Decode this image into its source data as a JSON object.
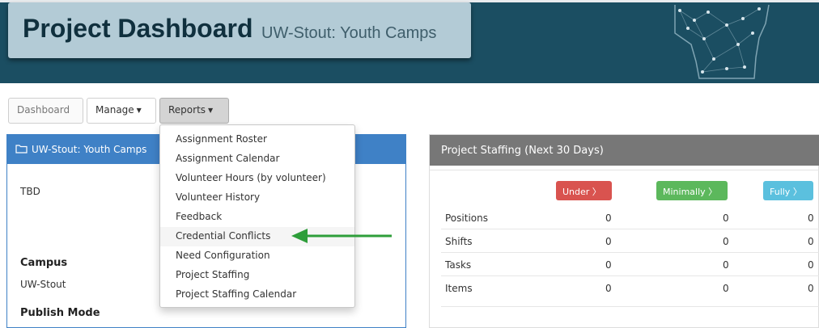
{
  "header": {
    "title": "Project Dashboard",
    "subtitle": "UW-Stout: Youth Camps",
    "logo_icon": "wisconsin-map-icon"
  },
  "nav": {
    "dashboard": "Dashboard",
    "manage": "Manage",
    "reports": "Reports"
  },
  "reports_menu": {
    "items": [
      "Assignment Roster",
      "Assignment Calendar",
      "Volunteer Hours (by volunteer)",
      "Volunteer History",
      "Feedback",
      "Credential Conflicts",
      "Need Configuration",
      "Project Staffing",
      "Project Staffing Calendar"
    ],
    "highlighted": "Credential Conflicts"
  },
  "project_panel": {
    "title": "UW-Stout: Youth Camps",
    "description": "TBD",
    "campus_label": "Campus",
    "campus_value": "UW-Stout",
    "publish_mode_label": "Publish Mode"
  },
  "staffing_panel": {
    "title": "Project Staffing (Next 30 Days)",
    "columns": [
      "Under",
      "Minimally",
      "Fully"
    ],
    "rows": [
      {
        "label": "Positions",
        "values": [
          "0",
          "0",
          "0"
        ]
      },
      {
        "label": "Shifts",
        "values": [
          "0",
          "0",
          "0"
        ]
      },
      {
        "label": "Tasks",
        "values": [
          "0",
          "0",
          "0"
        ]
      },
      {
        "label": "Items",
        "values": [
          "0",
          "0",
          "0"
        ]
      }
    ]
  },
  "colors": {
    "header_band": "#1b4e62",
    "title_box": "#b3cbd6",
    "panel_blue": "#3f81c6",
    "under": "#d9534f",
    "minimally": "#5cb85c",
    "fully": "#5bc0de",
    "arrow": "#2e9e3a"
  }
}
